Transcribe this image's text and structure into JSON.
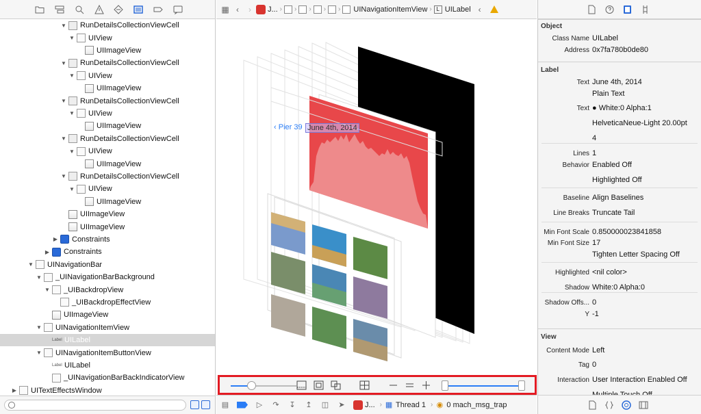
{
  "navigator": {
    "toolbar_icons": [
      "folder-icon",
      "hierarchy-icon",
      "search-icon",
      "warning-icon",
      "test-diamond-icon",
      "debug-list-icon",
      "breakpoint-icon",
      "report-icon"
    ],
    "tree": [
      {
        "label": "RunDetailsCollectionViewCell",
        "indent": 7,
        "disclosure": "open",
        "icon": "cell"
      },
      {
        "label": "UIView",
        "indent": 8,
        "disclosure": "open",
        "icon": "view"
      },
      {
        "label": "UIImageView",
        "indent": 9,
        "disclosure": "none",
        "icon": "img"
      },
      {
        "label": "RunDetailsCollectionViewCell",
        "indent": 7,
        "disclosure": "open",
        "icon": "cell"
      },
      {
        "label": "UIView",
        "indent": 8,
        "disclosure": "open",
        "icon": "view"
      },
      {
        "label": "UIImageView",
        "indent": 9,
        "disclosure": "none",
        "icon": "img"
      },
      {
        "label": "RunDetailsCollectionViewCell",
        "indent": 7,
        "disclosure": "open",
        "icon": "cell"
      },
      {
        "label": "UIView",
        "indent": 8,
        "disclosure": "open",
        "icon": "view"
      },
      {
        "label": "UIImageView",
        "indent": 9,
        "disclosure": "none",
        "icon": "img"
      },
      {
        "label": "RunDetailsCollectionViewCell",
        "indent": 7,
        "disclosure": "open",
        "icon": "cell"
      },
      {
        "label": "UIView",
        "indent": 8,
        "disclosure": "open",
        "icon": "view"
      },
      {
        "label": "UIImageView",
        "indent": 9,
        "disclosure": "none",
        "icon": "img"
      },
      {
        "label": "RunDetailsCollectionViewCell",
        "indent": 7,
        "disclosure": "open",
        "icon": "cell"
      },
      {
        "label": "UIView",
        "indent": 8,
        "disclosure": "open",
        "icon": "view"
      },
      {
        "label": "UIImageView",
        "indent": 9,
        "disclosure": "none",
        "icon": "img"
      },
      {
        "label": "UIImageView",
        "indent": 7,
        "disclosure": "none",
        "icon": "img"
      },
      {
        "label": "UIImageView",
        "indent": 7,
        "disclosure": "none",
        "icon": "img"
      },
      {
        "label": "Constraints",
        "indent": 6,
        "disclosure": "closed",
        "icon": "con"
      },
      {
        "label": "Constraints",
        "indent": 5,
        "disclosure": "closed",
        "icon": "con"
      },
      {
        "label": "UINavigationBar",
        "indent": 3,
        "disclosure": "open",
        "icon": "view"
      },
      {
        "label": "_UINavigationBarBackground",
        "indent": 4,
        "disclosure": "open",
        "icon": "view"
      },
      {
        "label": "_UIBackdropView",
        "indent": 5,
        "disclosure": "open",
        "icon": "view"
      },
      {
        "label": "_UIBackdropEffectView",
        "indent": 6,
        "disclosure": "none",
        "icon": "view"
      },
      {
        "label": "UIImageView",
        "indent": 5,
        "disclosure": "none",
        "icon": "img"
      },
      {
        "label": "UINavigationItemView",
        "indent": 4,
        "disclosure": "open",
        "icon": "view"
      },
      {
        "label": "UILabel",
        "indent": 5,
        "disclosure": "none",
        "icon": "label",
        "tag": "Label",
        "selected": true
      },
      {
        "label": "UINavigationItemButtonView",
        "indent": 4,
        "disclosure": "open",
        "icon": "view"
      },
      {
        "label": "UILabel",
        "indent": 5,
        "disclosure": "none",
        "icon": "label",
        "tag": "Label"
      },
      {
        "label": "_UINavigationBarBackIndicatorView",
        "indent": 5,
        "disclosure": "none",
        "icon": "view"
      },
      {
        "label": "UITextEffectsWindow",
        "indent": 1,
        "disclosure": "closed",
        "icon": "view"
      }
    ]
  },
  "jumpbar": {
    "app": "J...",
    "view": "UINavigationItemView",
    "leaf_tag": "L",
    "leaf": "UILabel"
  },
  "canvas": {
    "back_text": "Pier 39",
    "selected_label": "June 4th, 2014",
    "accent": "#e8474a"
  },
  "debugger_bar": {
    "app": "J...",
    "thread": "Thread 1",
    "frame": "0 mach_msg_trap"
  },
  "inspector": {
    "tabs": [
      "file-icon",
      "help-icon",
      "identity-icon",
      "size-icon"
    ],
    "object_section": "Object",
    "object_rows": [
      {
        "label": "Class Name",
        "value": "UILabel"
      },
      {
        "label": "Address",
        "value": "0x7fa780b0de80"
      }
    ],
    "label_section": "Label",
    "label_rows": [
      {
        "label": "Text",
        "value": "June 4th, 2014"
      },
      {
        "label": "",
        "value": "Plain Text"
      },
      {
        "label": "Text",
        "value": "● White:0 Alpha:1"
      },
      {
        "label": "",
        "value": "HelveticaNeue-Light 20.00pt"
      },
      {
        "label": "",
        "value": "4"
      },
      {
        "label": "Lines",
        "value": "1"
      },
      {
        "label": "Behavior",
        "value": "Enabled Off"
      },
      {
        "label": "",
        "value": "Highlighted Off"
      },
      {
        "label": "Baseline",
        "value": "Align Baselines"
      },
      {
        "label": "Line Breaks",
        "value": "Truncate Tail"
      },
      {
        "label": "Min Font Scale",
        "value": "0.850000023841858"
      },
      {
        "label": "Min Font Size",
        "value": "17"
      },
      {
        "label": "",
        "value": "Tighten Letter Spacing Off"
      },
      {
        "label": "Highlighted",
        "value": "<nil color>"
      },
      {
        "label": "Shadow",
        "value": "White:0 Alpha:0"
      },
      {
        "label": "Shadow Offs...",
        "value": "0"
      },
      {
        "label": "Y",
        "value": "-1"
      }
    ],
    "view_section": "View",
    "view_rows": [
      {
        "label": "Content Mode",
        "value": "Left"
      },
      {
        "label": "Tag",
        "value": "0"
      },
      {
        "label": "Interaction",
        "value": "User Interaction Enabled Off"
      },
      {
        "label": "",
        "value": "Multiple Touch Off"
      }
    ]
  }
}
